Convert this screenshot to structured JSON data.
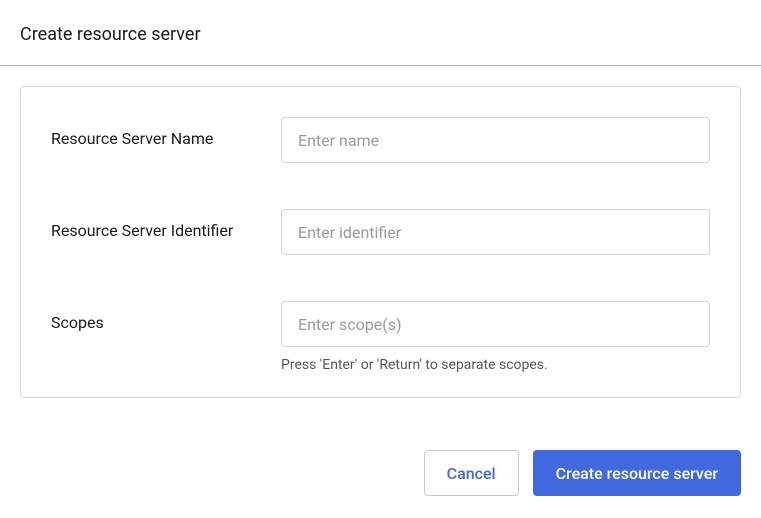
{
  "header": {
    "title": "Create resource server"
  },
  "form": {
    "name": {
      "label": "Resource Server Name",
      "placeholder": "Enter name",
      "value": ""
    },
    "identifier": {
      "label": "Resource Server Identifier",
      "placeholder": "Enter identifier",
      "value": ""
    },
    "scopes": {
      "label": "Scopes",
      "placeholder": "Enter scope(s)",
      "value": "",
      "hint": "Press 'Enter' or 'Return' to separate scopes."
    }
  },
  "actions": {
    "cancel": "Cancel",
    "submit": "Create resource server"
  }
}
